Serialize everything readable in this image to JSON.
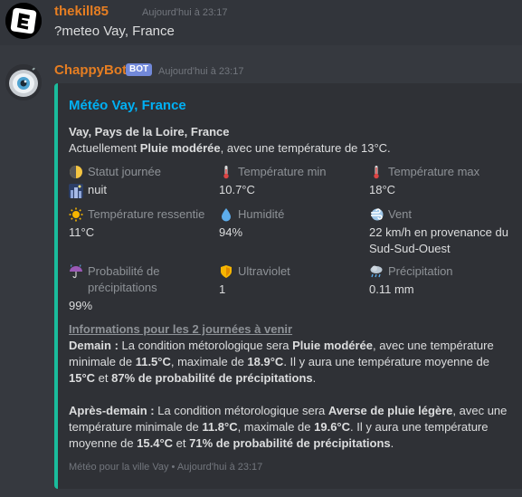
{
  "message1": {
    "username": "thekill85",
    "timestamp": "Aujourd'hui à 23:17",
    "content": "?meteo Vay, France"
  },
  "message2": {
    "username": "ChappyBot",
    "badge": "BOT",
    "timestamp": "Aujourd'hui à 23:17"
  },
  "embed": {
    "accent_color": "#1abc9c",
    "title": "Météo Vay, France",
    "location": "Vay, Pays de la Loire, France",
    "current_prefix": "Actuellement ",
    "current_condition": "Pluie modérée",
    "current_suffix": ", avec une température de 13°C.",
    "fields": [
      {
        "name": "Statut journée",
        "icon": "half-moon-icon",
        "value": "nuit",
        "value_icon": "night-city-icon"
      },
      {
        "name": "Température min",
        "icon": "thermometer-icon",
        "value": "10.7°C"
      },
      {
        "name": "Température max",
        "icon": "thermometer-icon",
        "value": "18°C"
      },
      {
        "name": "Température ressentie",
        "icon": "sun-icon",
        "value": "11°C"
      },
      {
        "name": "Humidité",
        "icon": "droplet-icon",
        "value": "94%"
      },
      {
        "name": "Vent",
        "icon": "wind-icon",
        "value": "22 km/h en provenance du Sud-Sud-Ouest"
      },
      {
        "name": "Probabilité de précipitations",
        "icon": "umbrella-rain-icon",
        "value": "99%"
      },
      {
        "name": "Ultraviolet",
        "icon": "shield-icon",
        "value": "1"
      },
      {
        "name": "Précipitation",
        "icon": "cloud-rain-icon",
        "value": "0.11 mm"
      }
    ],
    "forecast_title": "Informations pour les 2 journées à venir",
    "day1": {
      "label": "Demain :",
      "t1": " La condition métorologique sera ",
      "condition": "Pluie modérée",
      "t2": ", avec une température minimale de ",
      "min": "11.5°C",
      "t3": ", maximale de ",
      "max": "18.9°C",
      "t4": ". Il y aura une température moyenne de ",
      "avg": "15°C",
      "t5": " et ",
      "prob": "87% de probabilité de précipitations",
      "t6": "."
    },
    "day2": {
      "label": "Après-demain :",
      "t1": " La condition métorologique sera ",
      "condition": "Averse de pluie légère",
      "t2": ", avec une température minimale de ",
      "min": "11.8°C",
      "t3": ", maximale de ",
      "max": "19.6°C",
      "t4": ". Il y aura une température moyenne de ",
      "avg": "15.4°C",
      "t5": " et ",
      "prob": "71% de probabilité de précipitations",
      "t6": "."
    },
    "footer_text": "Météo pour la ville Vay",
    "footer_sep": "•",
    "footer_time": "Aujourd'hui à 23:17"
  }
}
